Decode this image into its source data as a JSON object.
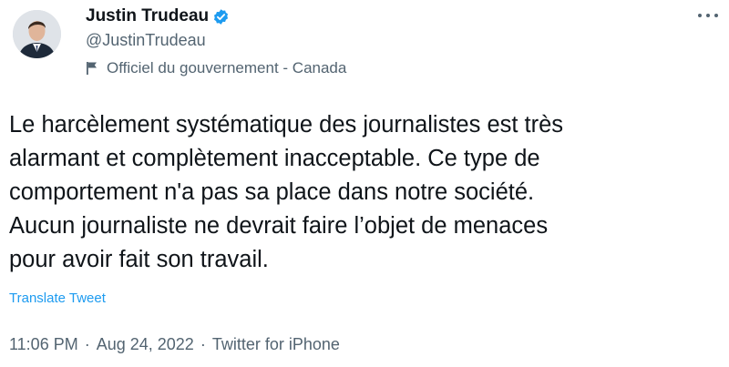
{
  "author": {
    "name": "Justin Trudeau",
    "handle": "@JustinTrudeau",
    "label": "Officiel du gouvernement - Canada",
    "verified_icon": "verified-badge-icon",
    "label_icon": "flag-icon"
  },
  "tweet": {
    "lines": [
      "Le harcèlement systématique des journalistes est très",
      "alarmant et complètement inacceptable. Ce type de",
      "comportement n'a pas sa place dans notre société.",
      "Aucun journaliste ne devrait faire l’objet de menaces",
      "pour avoir fait son travail."
    ],
    "translate_label": "Translate Tweet"
  },
  "meta": {
    "time": "11:06 PM",
    "separator": "·",
    "date": "Aug 24, 2022",
    "source": "Twitter for iPhone"
  },
  "colors": {
    "accent": "#1d9bf0",
    "text": "#0f1419",
    "secondary": "#536471"
  },
  "more_icon": "more-options-icon"
}
